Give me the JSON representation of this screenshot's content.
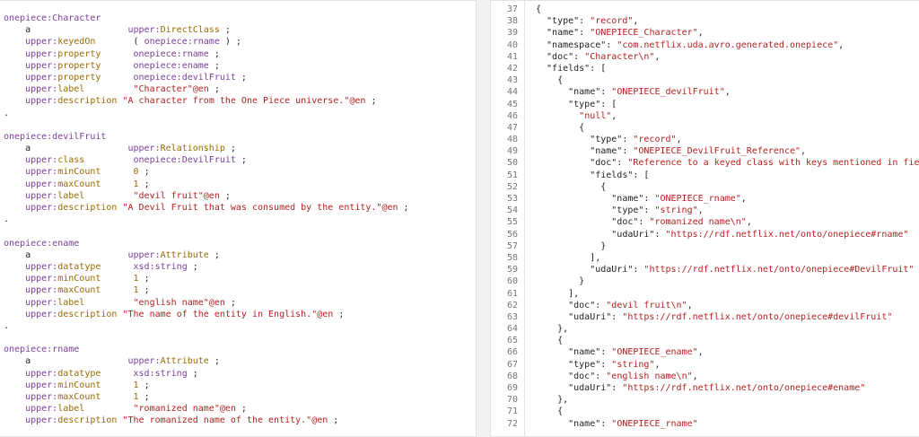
{
  "left_lines": [
    [
      [
        "onepiece:Character",
        "pname"
      ]
    ],
    [
      [
        "    a",
        "pun"
      ],
      [
        "                  upper:",
        "prefix"
      ],
      [
        "DirectClass",
        "local"
      ],
      [
        " ;",
        "pun"
      ]
    ],
    [
      [
        "    upper:",
        "prefix"
      ],
      [
        "keyedOn",
        "local"
      ],
      [
        "       ( ",
        "pun"
      ],
      [
        "onepiece:rname",
        "pname"
      ],
      [
        " ) ;",
        "pun"
      ]
    ],
    [
      [
        "    upper:",
        "prefix"
      ],
      [
        "property",
        "local"
      ],
      [
        "      ",
        "pun"
      ],
      [
        "onepiece:rname",
        "pname"
      ],
      [
        " ;",
        "pun"
      ]
    ],
    [
      [
        "    upper:",
        "prefix"
      ],
      [
        "property",
        "local"
      ],
      [
        "      ",
        "pun"
      ],
      [
        "onepiece:ename",
        "pname"
      ],
      [
        " ;",
        "pun"
      ]
    ],
    [
      [
        "    upper:",
        "prefix"
      ],
      [
        "property",
        "local"
      ],
      [
        "      ",
        "pun"
      ],
      [
        "onepiece:devilFruit",
        "pname"
      ],
      [
        " ;",
        "pun"
      ]
    ],
    [
      [
        "    upper:",
        "prefix"
      ],
      [
        "label",
        "local"
      ],
      [
        "         ",
        "pun"
      ],
      [
        "\"Character\"@en",
        "str"
      ],
      [
        " ;",
        "pun"
      ]
    ],
    [
      [
        "    upper:",
        "prefix"
      ],
      [
        "description",
        "local"
      ],
      [
        " ",
        "pun"
      ],
      [
        "\"A character from the One Piece universe.\"@en",
        "str"
      ],
      [
        " ;",
        "pun"
      ]
    ],
    [
      [
        ".",
        "pun"
      ]
    ],
    [
      [
        "",
        "pun"
      ]
    ],
    [
      [
        "onepiece:devilFruit",
        "pname"
      ]
    ],
    [
      [
        "    a",
        "pun"
      ],
      [
        "                  upper:",
        "prefix"
      ],
      [
        "Relationship",
        "local"
      ],
      [
        " ;",
        "pun"
      ]
    ],
    [
      [
        "    upper:",
        "prefix"
      ],
      [
        "class",
        "local"
      ],
      [
        "         ",
        "pun"
      ],
      [
        "onepiece:DevilFruit",
        "pname"
      ],
      [
        " ;",
        "pun"
      ]
    ],
    [
      [
        "    upper:",
        "prefix"
      ],
      [
        "minCount",
        "local"
      ],
      [
        "      ",
        "pun"
      ],
      [
        "0",
        "num"
      ],
      [
        " ;",
        "pun"
      ]
    ],
    [
      [
        "    upper:",
        "prefix"
      ],
      [
        "maxCount",
        "local"
      ],
      [
        "      ",
        "pun"
      ],
      [
        "1",
        "num"
      ],
      [
        " ;",
        "pun"
      ]
    ],
    [
      [
        "    upper:",
        "prefix"
      ],
      [
        "label",
        "local"
      ],
      [
        "         ",
        "pun"
      ],
      [
        "\"devil fruit\"@en",
        "str"
      ],
      [
        " ;",
        "pun"
      ]
    ],
    [
      [
        "    upper:",
        "prefix"
      ],
      [
        "description",
        "local"
      ],
      [
        " ",
        "pun"
      ],
      [
        "\"A Devil Fruit that was consumed by the entity.\"@en",
        "str"
      ],
      [
        " ;",
        "pun"
      ]
    ],
    [
      [
        ".",
        "pun"
      ]
    ],
    [
      [
        "",
        "pun"
      ]
    ],
    [
      [
        "onepiece:ename",
        "pname"
      ]
    ],
    [
      [
        "    a",
        "pun"
      ],
      [
        "                  upper:",
        "prefix"
      ],
      [
        "Attribute",
        "local"
      ],
      [
        " ;",
        "pun"
      ]
    ],
    [
      [
        "    upper:",
        "prefix"
      ],
      [
        "datatype",
        "local"
      ],
      [
        "      ",
        "pun"
      ],
      [
        "xsd:string",
        "pname"
      ],
      [
        " ;",
        "pun"
      ]
    ],
    [
      [
        "    upper:",
        "prefix"
      ],
      [
        "minCount",
        "local"
      ],
      [
        "      ",
        "pun"
      ],
      [
        "1",
        "num"
      ],
      [
        " ;",
        "pun"
      ]
    ],
    [
      [
        "    upper:",
        "prefix"
      ],
      [
        "maxCount",
        "local"
      ],
      [
        "      ",
        "pun"
      ],
      [
        "1",
        "num"
      ],
      [
        " ;",
        "pun"
      ]
    ],
    [
      [
        "    upper:",
        "prefix"
      ],
      [
        "label",
        "local"
      ],
      [
        "         ",
        "pun"
      ],
      [
        "\"english name\"@en",
        "str"
      ],
      [
        " ;",
        "pun"
      ]
    ],
    [
      [
        "    upper:",
        "prefix"
      ],
      [
        "description",
        "local"
      ],
      [
        " ",
        "pun"
      ],
      [
        "\"The name of the entity in English.\"@en",
        "str"
      ],
      [
        " ;",
        "pun"
      ]
    ],
    [
      [
        ".",
        "pun"
      ]
    ],
    [
      [
        "",
        "pun"
      ]
    ],
    [
      [
        "onepiece:rname",
        "pname"
      ]
    ],
    [
      [
        "    a",
        "pun"
      ],
      [
        "                  upper:",
        "prefix"
      ],
      [
        "Attribute",
        "local"
      ],
      [
        " ;",
        "pun"
      ]
    ],
    [
      [
        "    upper:",
        "prefix"
      ],
      [
        "datatype",
        "local"
      ],
      [
        "      ",
        "pun"
      ],
      [
        "xsd:string",
        "pname"
      ],
      [
        " ;",
        "pun"
      ]
    ],
    [
      [
        "    upper:",
        "prefix"
      ],
      [
        "minCount",
        "local"
      ],
      [
        "      ",
        "pun"
      ],
      [
        "1",
        "num"
      ],
      [
        " ;",
        "pun"
      ]
    ],
    [
      [
        "    upper:",
        "prefix"
      ],
      [
        "maxCount",
        "local"
      ],
      [
        "      ",
        "pun"
      ],
      [
        "1",
        "num"
      ],
      [
        " ;",
        "pun"
      ]
    ],
    [
      [
        "    upper:",
        "prefix"
      ],
      [
        "label",
        "local"
      ],
      [
        "         ",
        "pun"
      ],
      [
        "\"romanized name\"@en",
        "str"
      ],
      [
        " ;",
        "pun"
      ]
    ],
    [
      [
        "    upper:",
        "prefix"
      ],
      [
        "description",
        "local"
      ],
      [
        " ",
        "pun"
      ],
      [
        "\"The romanized name of the entity.\"@en",
        "str"
      ],
      [
        " ;",
        "pun"
      ]
    ]
  ],
  "right_lines": [
    {
      "n": "37",
      "t": [
        [
          "{",
          "pun"
        ]
      ]
    },
    {
      "n": "38",
      "t": [
        [
          "  \"type\": ",
          "key"
        ],
        [
          "\"record\"",
          "val"
        ],
        [
          ",",
          "pun"
        ]
      ]
    },
    {
      "n": "39",
      "t": [
        [
          "  \"name\": ",
          "key"
        ],
        [
          "\"ONEPIECE_Character\"",
          "val"
        ],
        [
          ",",
          "pun"
        ]
      ]
    },
    {
      "n": "40",
      "t": [
        [
          "  \"namespace\": ",
          "key"
        ],
        [
          "\"com.netflix.uda.avro.generated.onepiece\"",
          "val"
        ],
        [
          ",",
          "pun"
        ]
      ]
    },
    {
      "n": "41",
      "t": [
        [
          "  \"doc\": ",
          "key"
        ],
        [
          "\"Character\\n\"",
          "val"
        ],
        [
          ",",
          "pun"
        ]
      ]
    },
    {
      "n": "42",
      "t": [
        [
          "  \"fields\": [",
          "key"
        ]
      ]
    },
    {
      "n": "43",
      "t": [
        [
          "    {",
          "pun"
        ]
      ]
    },
    {
      "n": "44",
      "t": [
        [
          "      \"name\": ",
          "key"
        ],
        [
          "\"ONEPIECE_devilFruit\"",
          "val"
        ],
        [
          ",",
          "pun"
        ]
      ]
    },
    {
      "n": "45",
      "t": [
        [
          "      \"type\": [",
          "key"
        ]
      ]
    },
    {
      "n": "46",
      "t": [
        [
          "        ",
          "pun"
        ],
        [
          "\"null\"",
          "val"
        ],
        [
          ",",
          "pun"
        ]
      ]
    },
    {
      "n": "47",
      "t": [
        [
          "        {",
          "pun"
        ]
      ]
    },
    {
      "n": "48",
      "t": [
        [
          "          \"type\": ",
          "key"
        ],
        [
          "\"record\"",
          "val"
        ],
        [
          ",",
          "pun"
        ]
      ]
    },
    {
      "n": "49",
      "t": [
        [
          "          \"name\": ",
          "key"
        ],
        [
          "\"ONEPIECE_DevilFruit_Reference\"",
          "val"
        ],
        [
          ",",
          "pun"
        ]
      ]
    },
    {
      "n": "50",
      "t": [
        [
          "          \"doc\": ",
          "key"
        ],
        [
          "\"Reference to a keyed class with keys mentioned in fiel",
          "val"
        ]
      ]
    },
    {
      "n": "51",
      "t": [
        [
          "          \"fields\": [",
          "key"
        ]
      ]
    },
    {
      "n": "52",
      "t": [
        [
          "            {",
          "pun"
        ]
      ]
    },
    {
      "n": "53",
      "t": [
        [
          "              \"name\": ",
          "key"
        ],
        [
          "\"ONEPIECE_rname\"",
          "val"
        ],
        [
          ",",
          "pun"
        ]
      ]
    },
    {
      "n": "54",
      "t": [
        [
          "              \"type\": ",
          "key"
        ],
        [
          "\"string\"",
          "val"
        ],
        [
          ",",
          "pun"
        ]
      ]
    },
    {
      "n": "55",
      "t": [
        [
          "              \"doc\": ",
          "key"
        ],
        [
          "\"romanized name\\n\"",
          "val"
        ],
        [
          ",",
          "pun"
        ]
      ]
    },
    {
      "n": "56",
      "t": [
        [
          "              \"udaUri\": ",
          "key"
        ],
        [
          "\"https://rdf.netflix.net/onto/onepiece#rname\"",
          "val"
        ]
      ]
    },
    {
      "n": "57",
      "t": [
        [
          "            }",
          "pun"
        ]
      ]
    },
    {
      "n": "58",
      "t": [
        [
          "          ],",
          "pun"
        ]
      ]
    },
    {
      "n": "59",
      "t": [
        [
          "          \"udaUri\": ",
          "key"
        ],
        [
          "\"https://rdf.netflix.net/onto/onepiece#DevilFruit\"",
          "val"
        ]
      ]
    },
    {
      "n": "60",
      "t": [
        [
          "        }",
          "pun"
        ]
      ]
    },
    {
      "n": "61",
      "t": [
        [
          "      ],",
          "pun"
        ]
      ]
    },
    {
      "n": "62",
      "t": [
        [
          "      \"doc\": ",
          "key"
        ],
        [
          "\"devil fruit\\n\"",
          "val"
        ],
        [
          ",",
          "pun"
        ]
      ]
    },
    {
      "n": "63",
      "t": [
        [
          "      \"udaUri\": ",
          "key"
        ],
        [
          "\"https://rdf.netflix.net/onto/onepiece#devilFruit\"",
          "val"
        ]
      ]
    },
    {
      "n": "64",
      "t": [
        [
          "    },",
          "pun"
        ]
      ]
    },
    {
      "n": "65",
      "t": [
        [
          "    {",
          "pun"
        ]
      ]
    },
    {
      "n": "66",
      "t": [
        [
          "      \"name\": ",
          "key"
        ],
        [
          "\"ONEPIECE_ename\"",
          "val"
        ],
        [
          ",",
          "pun"
        ]
      ]
    },
    {
      "n": "67",
      "t": [
        [
          "      \"type\": ",
          "key"
        ],
        [
          "\"string\"",
          "val"
        ],
        [
          ",",
          "pun"
        ]
      ]
    },
    {
      "n": "68",
      "t": [
        [
          "      \"doc\": ",
          "key"
        ],
        [
          "\"english name\\n\"",
          "val"
        ],
        [
          ",",
          "pun"
        ]
      ]
    },
    {
      "n": "69",
      "t": [
        [
          "      \"udaUri\": ",
          "key"
        ],
        [
          "\"https://rdf.netflix.net/onto/onepiece#ename\"",
          "val"
        ]
      ]
    },
    {
      "n": "70",
      "t": [
        [
          "    },",
          "pun"
        ]
      ]
    },
    {
      "n": "71",
      "t": [
        [
          "    {",
          "pun"
        ]
      ]
    },
    {
      "n": "72",
      "t": [
        [
          "      \"name\": ",
          "key"
        ],
        [
          "\"ONEPIECE_rname\"",
          "val"
        ]
      ]
    }
  ]
}
